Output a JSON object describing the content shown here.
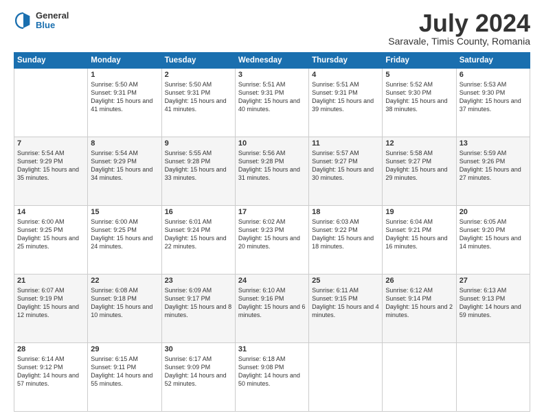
{
  "header": {
    "logo": {
      "general": "General",
      "blue": "Blue"
    },
    "title": "July 2024",
    "subtitle": "Saravale, Timis County, Romania"
  },
  "days_of_week": [
    "Sunday",
    "Monday",
    "Tuesday",
    "Wednesday",
    "Thursday",
    "Friday",
    "Saturday"
  ],
  "weeks": [
    [
      {
        "day": "",
        "sunrise": "",
        "sunset": "",
        "daylight": ""
      },
      {
        "day": "1",
        "sunrise": "Sunrise: 5:50 AM",
        "sunset": "Sunset: 9:31 PM",
        "daylight": "Daylight: 15 hours and 41 minutes."
      },
      {
        "day": "2",
        "sunrise": "Sunrise: 5:50 AM",
        "sunset": "Sunset: 9:31 PM",
        "daylight": "Daylight: 15 hours and 41 minutes."
      },
      {
        "day": "3",
        "sunrise": "Sunrise: 5:51 AM",
        "sunset": "Sunset: 9:31 PM",
        "daylight": "Daylight: 15 hours and 40 minutes."
      },
      {
        "day": "4",
        "sunrise": "Sunrise: 5:51 AM",
        "sunset": "Sunset: 9:31 PM",
        "daylight": "Daylight: 15 hours and 39 minutes."
      },
      {
        "day": "5",
        "sunrise": "Sunrise: 5:52 AM",
        "sunset": "Sunset: 9:30 PM",
        "daylight": "Daylight: 15 hours and 38 minutes."
      },
      {
        "day": "6",
        "sunrise": "Sunrise: 5:53 AM",
        "sunset": "Sunset: 9:30 PM",
        "daylight": "Daylight: 15 hours and 37 minutes."
      }
    ],
    [
      {
        "day": "7",
        "sunrise": "Sunrise: 5:54 AM",
        "sunset": "Sunset: 9:29 PM",
        "daylight": "Daylight: 15 hours and 35 minutes."
      },
      {
        "day": "8",
        "sunrise": "Sunrise: 5:54 AM",
        "sunset": "Sunset: 9:29 PM",
        "daylight": "Daylight: 15 hours and 34 minutes."
      },
      {
        "day": "9",
        "sunrise": "Sunrise: 5:55 AM",
        "sunset": "Sunset: 9:28 PM",
        "daylight": "Daylight: 15 hours and 33 minutes."
      },
      {
        "day": "10",
        "sunrise": "Sunrise: 5:56 AM",
        "sunset": "Sunset: 9:28 PM",
        "daylight": "Daylight: 15 hours and 31 minutes."
      },
      {
        "day": "11",
        "sunrise": "Sunrise: 5:57 AM",
        "sunset": "Sunset: 9:27 PM",
        "daylight": "Daylight: 15 hours and 30 minutes."
      },
      {
        "day": "12",
        "sunrise": "Sunrise: 5:58 AM",
        "sunset": "Sunset: 9:27 PM",
        "daylight": "Daylight: 15 hours and 29 minutes."
      },
      {
        "day": "13",
        "sunrise": "Sunrise: 5:59 AM",
        "sunset": "Sunset: 9:26 PM",
        "daylight": "Daylight: 15 hours and 27 minutes."
      }
    ],
    [
      {
        "day": "14",
        "sunrise": "Sunrise: 6:00 AM",
        "sunset": "Sunset: 9:25 PM",
        "daylight": "Daylight: 15 hours and 25 minutes."
      },
      {
        "day": "15",
        "sunrise": "Sunrise: 6:00 AM",
        "sunset": "Sunset: 9:25 PM",
        "daylight": "Daylight: 15 hours and 24 minutes."
      },
      {
        "day": "16",
        "sunrise": "Sunrise: 6:01 AM",
        "sunset": "Sunset: 9:24 PM",
        "daylight": "Daylight: 15 hours and 22 minutes."
      },
      {
        "day": "17",
        "sunrise": "Sunrise: 6:02 AM",
        "sunset": "Sunset: 9:23 PM",
        "daylight": "Daylight: 15 hours and 20 minutes."
      },
      {
        "day": "18",
        "sunrise": "Sunrise: 6:03 AM",
        "sunset": "Sunset: 9:22 PM",
        "daylight": "Daylight: 15 hours and 18 minutes."
      },
      {
        "day": "19",
        "sunrise": "Sunrise: 6:04 AM",
        "sunset": "Sunset: 9:21 PM",
        "daylight": "Daylight: 15 hours and 16 minutes."
      },
      {
        "day": "20",
        "sunrise": "Sunrise: 6:05 AM",
        "sunset": "Sunset: 9:20 PM",
        "daylight": "Daylight: 15 hours and 14 minutes."
      }
    ],
    [
      {
        "day": "21",
        "sunrise": "Sunrise: 6:07 AM",
        "sunset": "Sunset: 9:19 PM",
        "daylight": "Daylight: 15 hours and 12 minutes."
      },
      {
        "day": "22",
        "sunrise": "Sunrise: 6:08 AM",
        "sunset": "Sunset: 9:18 PM",
        "daylight": "Daylight: 15 hours and 10 minutes."
      },
      {
        "day": "23",
        "sunrise": "Sunrise: 6:09 AM",
        "sunset": "Sunset: 9:17 PM",
        "daylight": "Daylight: 15 hours and 8 minutes."
      },
      {
        "day": "24",
        "sunrise": "Sunrise: 6:10 AM",
        "sunset": "Sunset: 9:16 PM",
        "daylight": "Daylight: 15 hours and 6 minutes."
      },
      {
        "day": "25",
        "sunrise": "Sunrise: 6:11 AM",
        "sunset": "Sunset: 9:15 PM",
        "daylight": "Daylight: 15 hours and 4 minutes."
      },
      {
        "day": "26",
        "sunrise": "Sunrise: 6:12 AM",
        "sunset": "Sunset: 9:14 PM",
        "daylight": "Daylight: 15 hours and 2 minutes."
      },
      {
        "day": "27",
        "sunrise": "Sunrise: 6:13 AM",
        "sunset": "Sunset: 9:13 PM",
        "daylight": "Daylight: 14 hours and 59 minutes."
      }
    ],
    [
      {
        "day": "28",
        "sunrise": "Sunrise: 6:14 AM",
        "sunset": "Sunset: 9:12 PM",
        "daylight": "Daylight: 14 hours and 57 minutes."
      },
      {
        "day": "29",
        "sunrise": "Sunrise: 6:15 AM",
        "sunset": "Sunset: 9:11 PM",
        "daylight": "Daylight: 14 hours and 55 minutes."
      },
      {
        "day": "30",
        "sunrise": "Sunrise: 6:17 AM",
        "sunset": "Sunset: 9:09 PM",
        "daylight": "Daylight: 14 hours and 52 minutes."
      },
      {
        "day": "31",
        "sunrise": "Sunrise: 6:18 AM",
        "sunset": "Sunset: 9:08 PM",
        "daylight": "Daylight: 14 hours and 50 minutes."
      },
      {
        "day": "",
        "sunrise": "",
        "sunset": "",
        "daylight": ""
      },
      {
        "day": "",
        "sunrise": "",
        "sunset": "",
        "daylight": ""
      },
      {
        "day": "",
        "sunrise": "",
        "sunset": "",
        "daylight": ""
      }
    ]
  ]
}
